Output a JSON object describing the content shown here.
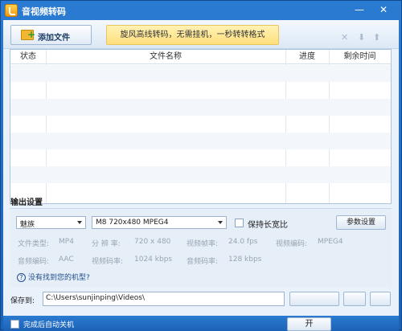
{
  "window": {
    "title": "音视频转码",
    "minimize_icon": "—",
    "close_icon": "✕"
  },
  "toolbar": {
    "add_file_label": "添加文件",
    "banner_text": "旋风高线转码，无需挂机，一秒转转格式",
    "delete_icon": "✕",
    "move_down_icon": "⬇",
    "move_up_icon": "⬆"
  },
  "table": {
    "columns": [
      "状态",
      "文件名称",
      "进度",
      "剩余时间"
    ],
    "rows": []
  },
  "output": {
    "section_title": "输出设置",
    "brand_value": "魅族",
    "model_value": "M8 720x480 MPEG4",
    "keep_ratio_label": "保持长宽比",
    "param_button_label": "参数设置",
    "specs": {
      "file_type_label": "文件类型:",
      "file_type_value": "MP4",
      "resolution_label": "分 辨 率:",
      "resolution_value": "720 x 480",
      "frame_rate_label": "视频帧率:",
      "frame_rate_value": "24.0 fps",
      "video_codec_label": "视频编码:",
      "video_codec_value": "MPEG4",
      "audio_codec_label": "音频编码:",
      "audio_codec_value": "AAC",
      "video_bitrate_label": "视频码率:",
      "video_bitrate_value": "1024 kbps",
      "audio_bitrate_label": "音频码率:",
      "audio_bitrate_value": "128 kbps"
    },
    "help_text": "没有找到您的机型?"
  },
  "save": {
    "label": "保存到:",
    "path": "C:\\Users\\sunjinping\\Videos\\"
  },
  "bottom": {
    "shutdown_label": "完成后自动关机",
    "start_label": "开"
  }
}
